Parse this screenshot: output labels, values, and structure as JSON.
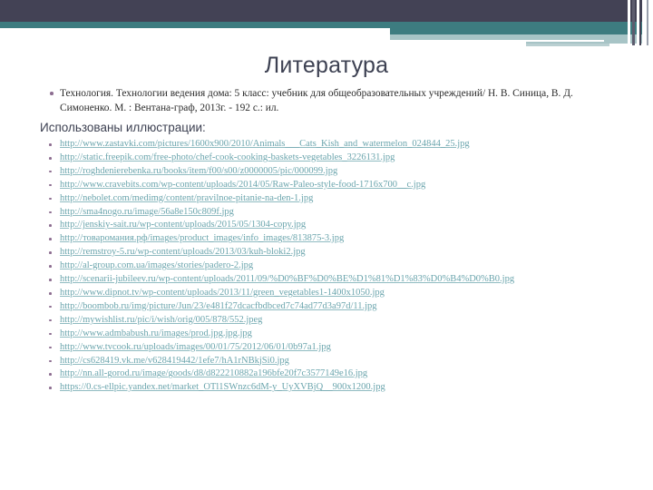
{
  "slide": {
    "title": "Литература",
    "theme": {
      "dark_band": "#434255",
      "teal_band": "#3d7c80",
      "light_teal_band": "#a7c4c6",
      "title_color": "#3d4152",
      "link_color": "#6ba5ad",
      "bullet_color": "#8d6e91",
      "background": "#ffffff"
    },
    "reference": "Технология. Технологии ведения дома: 5 класс: учебник для общеобразовательных учреждений/  Н. В. Синица, В. Д. Симоненко. М. : Вентана-граф, 2013г. -  192 с.: ил.",
    "illustrations_heading": "Использованы иллюстрации:",
    "links": [
      "http://www.zastavki.com/pictures/1600x900/2010/Animals___Cats_Kish_and_watermelon_024844_25.jpg",
      "http://static.freepik.com/free-photo/chef-cook-cooking-baskets-vegetables_3226131.jpg",
      "http://roghdenierebenka.ru/books/item/f00/s00/z0000005/pic/000099.jpg",
      "http://www.cravebits.com/wp-content/uploads/2014/05/Raw-Paleo-style-food-1716x700__c.jpg",
      "http://nebolet.com/medimg/content/pravilnoe-pitanie-na-den-1.jpg",
      "http://sma4nogo.ru/image/56a8e150c809f.jpg",
      "http://jenskiy-sait.ru/wp-content/uploads/2015/05/1304-copy.jpg",
      "http://товаромания.рф/images/product_images/info_images/813875-3.jpg",
      "http://remstroy-5.ru/wp-content/uploads/2013/03/kuh-bloki2.jpg",
      "http://al-group.com.ua/images/stories/padero-2.jpg",
      "http://scenarii-jubileev.ru/wp-content/uploads/2011/09/%D0%BF%D0%BE%D1%81%D1%83%D0%B4%D0%B0.jpg",
      "http://www.dipnot.tv/wp-content/uploads/2013/11/green_vegetables1-1400x1050.jpg",
      "http://boombob.ru/img/picture/Jun/23/e481f27dcacfbdbced7c74ad77d3a97d/11.jpg",
      "http://mywishlist.ru/pic/i/wish/orig/005/878/552.jpeg",
      "http://www.admbabush.ru/images/prod.jpg.jpg.jpg",
      "http://www.tvcook.ru/uploads/images/00/01/75/2012/06/01/0b97a1.jpg",
      "http://cs628419.vk.me/v628419442/1efe7/hA1rNBkjSi0.jpg",
      "http://nn.all-gorod.ru/image/goods/d8/d822210882a196bfe20f7c3577149e16.jpg",
      "https://0.cs-ellpic.yandex.net/market_OTl1SWnzc6dM-y_UyXVBjQ__900x1200.jpg"
    ]
  }
}
